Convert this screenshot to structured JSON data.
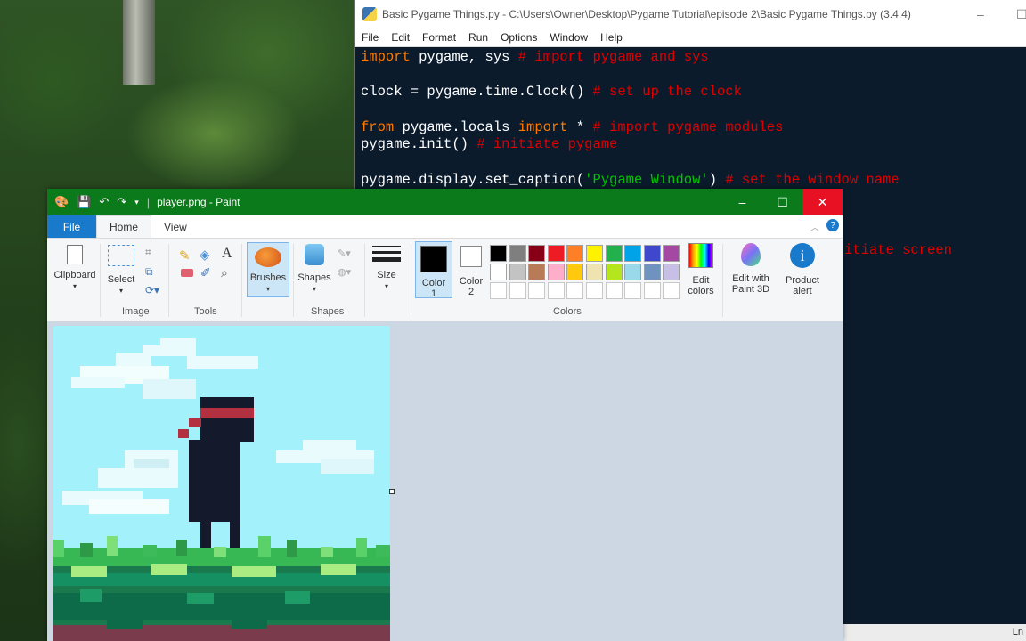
{
  "idle": {
    "title": "Basic Pygame Things.py - C:\\Users\\Owner\\Desktop\\Pygame Tutorial\\episode 2\\Basic Pygame Things.py (3.4.4)",
    "menu": [
      "File",
      "Edit",
      "Format",
      "Run",
      "Options",
      "Window",
      "Help"
    ],
    "code": [
      {
        "kw": "import",
        "tx": " pygame, sys ",
        "cm": "# import pygame and sys"
      },
      {
        "tx": "clock = pygame.time.Clock() ",
        "cm": "# set up the clock"
      },
      {
        "kw1": "from",
        "tx1": " pygame.locals ",
        "kw2": "import",
        "tx2": " * ",
        "cm": "# import pygame modules"
      },
      {
        "tx": "pygame.init() ",
        "cm": "# initiate pygame"
      },
      {
        "tx1": "pygame.display.set_caption(",
        "st": "'Pygame Window'",
        "tx2": ") ",
        "cm": "# set the window name"
      },
      {
        "cm": "itiate screen"
      }
    ],
    "status": "Ln"
  },
  "paint": {
    "title": "player.png - Paint",
    "tabs": {
      "file": "File",
      "home": "Home",
      "view": "View"
    },
    "ribbon": {
      "clipboard": "Clipboard",
      "select": "Select",
      "image_group": "Image",
      "tools_group": "Tools",
      "brushes": "Brushes",
      "shapes": "Shapes",
      "shapes_group": "Shapes",
      "size": "Size",
      "color1_a": "Color",
      "color1_b": "1",
      "color2_a": "Color",
      "color2_b": "2",
      "colors_group": "Colors",
      "edit_colors_a": "Edit",
      "edit_colors_b": "colors",
      "paint3d_a": "Edit with",
      "paint3d_b": "Paint 3D",
      "product_alert_a": "Product",
      "product_alert_b": "alert",
      "text_tool": "A"
    },
    "color1": "#000000",
    "color2": "#ffffff",
    "palette_row1": [
      "#000000",
      "#7f7f7f",
      "#880015",
      "#ed1c24",
      "#ff7f27",
      "#fff200",
      "#22b14c",
      "#00a2e8",
      "#3f48cc",
      "#a349a4"
    ],
    "palette_row2": [
      "#ffffff",
      "#c3c3c3",
      "#b97a57",
      "#ffaec9",
      "#ffc90e",
      "#efe4b0",
      "#b5e61d",
      "#99d9ea",
      "#7092be",
      "#c8bfe7"
    ]
  }
}
